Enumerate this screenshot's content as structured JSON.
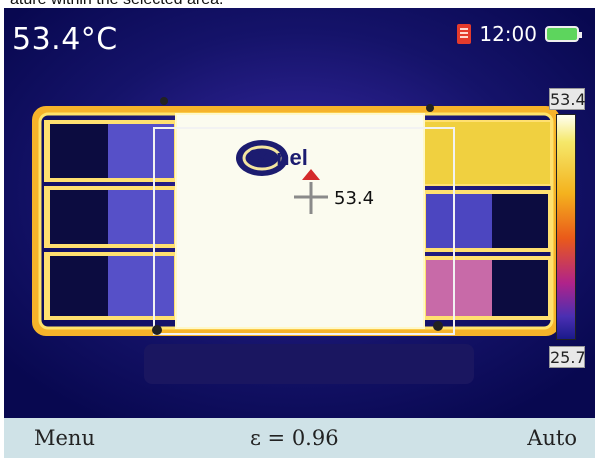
{
  "caption": "ature within the selected area.",
  "screen": {
    "temperature": "53.4°C",
    "time": "12:00",
    "icons": {
      "sd": "sd-card-icon",
      "battery": "battery-icon",
      "crosshair": "crosshair-icon",
      "max_marker": "max-marker-icon"
    },
    "scale": {
      "max": "53.4",
      "min": "25.7"
    },
    "point_value": "53.4",
    "logo_text": "Sonel"
  },
  "bottom_bar": {
    "menu": "Menu",
    "emissivity": "ε = 0.96",
    "mode": "Auto"
  },
  "colors": {
    "screen_bg": "#0a0a5a",
    "hot": "#fffff0",
    "warm": "#f5e050",
    "cool": "#6a62d8",
    "bar_bg": "#cfe2e7"
  }
}
